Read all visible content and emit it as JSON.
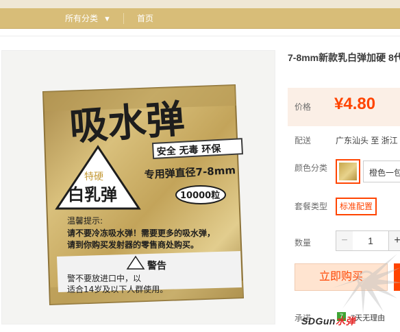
{
  "nav": {
    "all_categories": "所有分类",
    "home": "首页"
  },
  "product": {
    "title": "7-8mm新款乳白弹加硬 8代",
    "price_label": "价格",
    "price": "¥4.80",
    "shipping_label": "配送",
    "shipping_value": "广东汕头 至 浙江",
    "color_label": "颜色分类",
    "color_option": "橙色一包",
    "package_label": "套餐类型",
    "package_option": "标准配置",
    "quantity_label": "数量",
    "quantity_value": "1",
    "buy_now": "立即购买",
    "promise_label": "承诺",
    "promise_badge": "7",
    "promise_text": "7天无理由"
  },
  "package_art": {
    "brand": "吸水弹",
    "hard_badge": "特硬",
    "milk_white": "白乳弹",
    "slogan": "安全 无毒 环保",
    "diameter": "专用弹直径7-8mm",
    "count": "10000粒",
    "tip_title": "温馨提示:",
    "tip_line1": "请不要冷冻吸水弹！需要更多的吸水弹，",
    "tip_line2": "请到你购买发射器的零售商处购买。",
    "warning_title": "警告",
    "warning_line1": "警不要放进口中，以",
    "warning_line2": "适合14岁及以下人群使用。"
  },
  "watermark": {
    "prefix": "SDGun",
    "suffix": "水弹"
  },
  "colors": {
    "nav_bg": "#d8bd78",
    "price_red": "#ff4400",
    "gold_bag": "#c8a74c"
  }
}
